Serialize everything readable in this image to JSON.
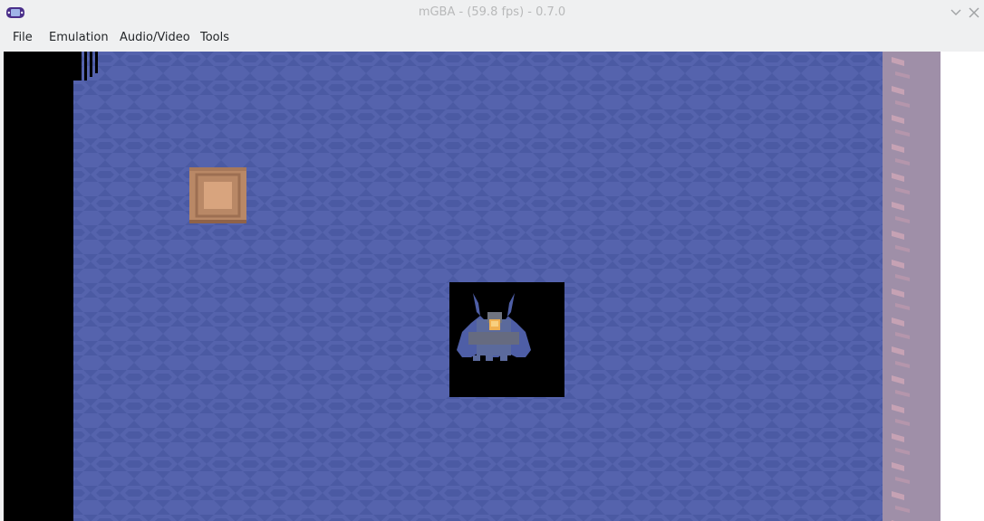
{
  "window": {
    "title": "mGBA - (59.8 fps) - 0.7.0",
    "app_icon": "gba-console-icon",
    "controls": [
      "chevron-down-icon",
      "close-icon"
    ]
  },
  "menubar": {
    "items": [
      {
        "label": "File"
      },
      {
        "label": "Emulation"
      },
      {
        "label": "Audio/Video"
      },
      {
        "label": "Tools"
      }
    ]
  },
  "game": {
    "scene": "water-field",
    "objects": [
      "pushable-block-icon",
      "bat-monster-sprite"
    ],
    "colors": {
      "water": "#4b5aa3",
      "water_pattern": "#5a68b0",
      "border": "#000000",
      "bank": "#9a8aa5",
      "bank_stripe": "#c2a0b3",
      "block": "#b98866"
    }
  }
}
